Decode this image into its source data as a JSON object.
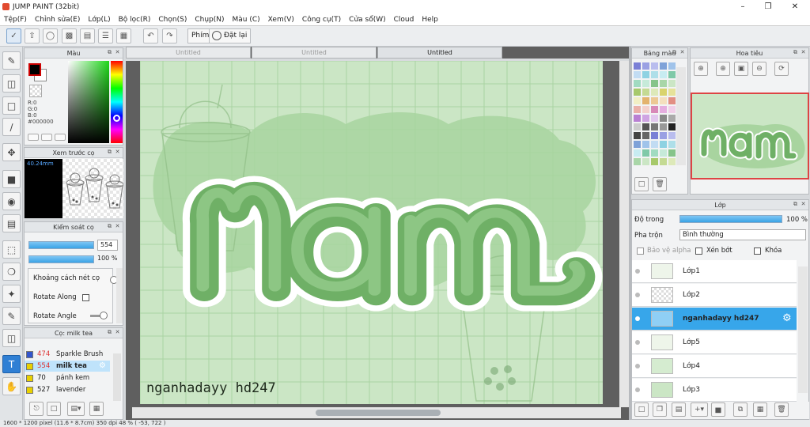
{
  "app": {
    "title": "JUMP PAINT (32bit)"
  },
  "menu": [
    "Tệp(F)",
    "Chỉnh sửa(E)",
    "Lớp(L)",
    "Bộ lọc(R)",
    "Chọn(S)",
    "Chụp(N)",
    "Màu (C)",
    "Xem(V)",
    "Công cụ(T)",
    "Cửa sổ(W)",
    "Cloud",
    "Help"
  ],
  "toolbar": {
    "keys_label": "Phím",
    "reset_label": "Đặt lại"
  },
  "color_panel": {
    "title": "Màu",
    "r": "R:0",
    "g": "G:0",
    "b": "B:0",
    "hex": "#000000",
    "primary": "#000000",
    "secondary": "#ffffff"
  },
  "brush_preview": {
    "title": "Xem trước cọ",
    "size": "40.24mm"
  },
  "brush_control": {
    "title": "Kiểm soát cọ",
    "size_value": "554",
    "opacity_value": "100 %",
    "options": [
      "Khoảng cách nét cọ",
      "Rotate Along",
      "Rotate Angle"
    ]
  },
  "brush_list": {
    "title": "Cọ: milk tea",
    "items": [
      {
        "num": "474",
        "name": "Sparkle Brush",
        "color": "#3355cc",
        "selected": false
      },
      {
        "num": "554",
        "name": "milk tea",
        "color": "#e8d000",
        "selected": true
      },
      {
        "num": "70",
        "name": "pánh kem",
        "color": "#e8d000",
        "selected": false
      },
      {
        "num": "527",
        "name": "lavender",
        "color": "#e8d000",
        "selected": false
      }
    ]
  },
  "tabs": [
    "Untitled",
    "Untitled",
    "Untitled"
  ],
  "canvas": {
    "title_text": "nam",
    "credit": "nganhadayy hd247",
    "grid_color": "#8fbf8a",
    "bg": "#cbe6c5"
  },
  "palette_panel": {
    "title": "Bảng màu"
  },
  "navigator_panel": {
    "title": "Hoa tiêu"
  },
  "layer_panel": {
    "title": "Lớp",
    "opacity_label": "Độ trong",
    "opacity_value": "100 %",
    "blend_label": "Pha trộn",
    "blend_value": "Bình thường",
    "protect_alpha": "Bảo vệ alpha",
    "clip": "Xén bớt",
    "lock": "Khóa",
    "layers": [
      {
        "name": "Lớp1",
        "selected": false
      },
      {
        "name": "Lớp2",
        "selected": false
      },
      {
        "name": "nganhadayy hd247",
        "selected": true
      },
      {
        "name": "Lớp5",
        "selected": false
      },
      {
        "name": "Lớp4",
        "selected": false
      },
      {
        "name": "Lớp3",
        "selected": false
      }
    ]
  },
  "status": {
    "text": "1600 * 1200 pixel   (11.6 * 8.7cm)   350 dpi   48 %   ( -53, 722 )"
  }
}
